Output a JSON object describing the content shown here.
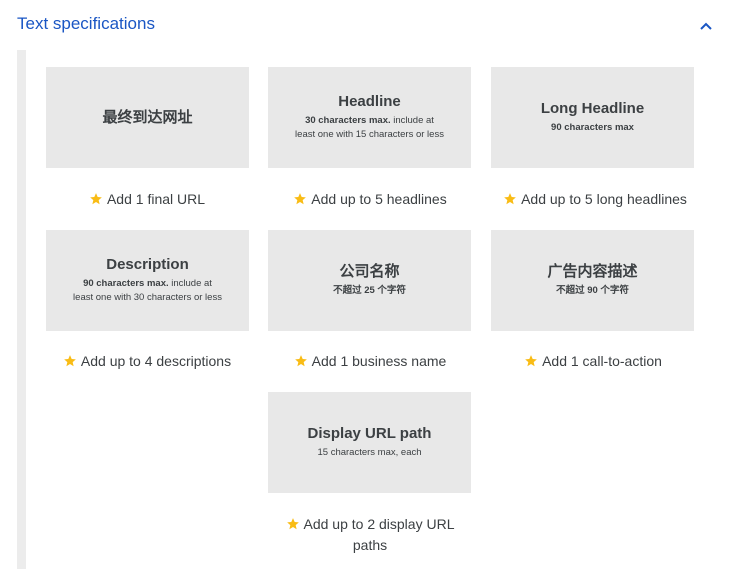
{
  "section": {
    "title": "Text specifications",
    "accent": "#1a56c4",
    "star_color": "#f9bc15"
  },
  "cards": [
    {
      "title": "最终到达网址",
      "sub_bold": "",
      "sub_rest": "",
      "sub_line2": "",
      "requirement": "Add 1 final URL"
    },
    {
      "title": "Headline",
      "sub_bold": "30 characters max.",
      "sub_rest": " include at",
      "sub_line2": "least one with 15 characters or less",
      "requirement": "Add up to 5 headlines"
    },
    {
      "title": "Long Headline",
      "sub_bold": "90 characters max",
      "sub_rest": "",
      "sub_line2": "",
      "requirement": "Add up to 5 long headlines"
    },
    {
      "title": "Description",
      "sub_bold": "90 characters max.",
      "sub_rest": " include at",
      "sub_line2": "least one with 30 characters or less",
      "requirement": "Add up to 4 descriptions"
    },
    {
      "title": "公司名称",
      "sub_bold": "不超过 25 个字符",
      "sub_rest": "",
      "sub_line2": "",
      "requirement": "Add 1 business name"
    },
    {
      "title": "广告内容描述",
      "sub_bold": "不超过 90 个字符",
      "sub_rest": "",
      "sub_line2": "",
      "requirement": "Add 1 call-to-action"
    },
    {
      "title": "Display URL path",
      "sub_bold": "",
      "sub_rest": "15 characters max, each",
      "sub_line2": "",
      "requirement_line1": "Add up to 2 display URL",
      "requirement_line2": "paths"
    }
  ]
}
